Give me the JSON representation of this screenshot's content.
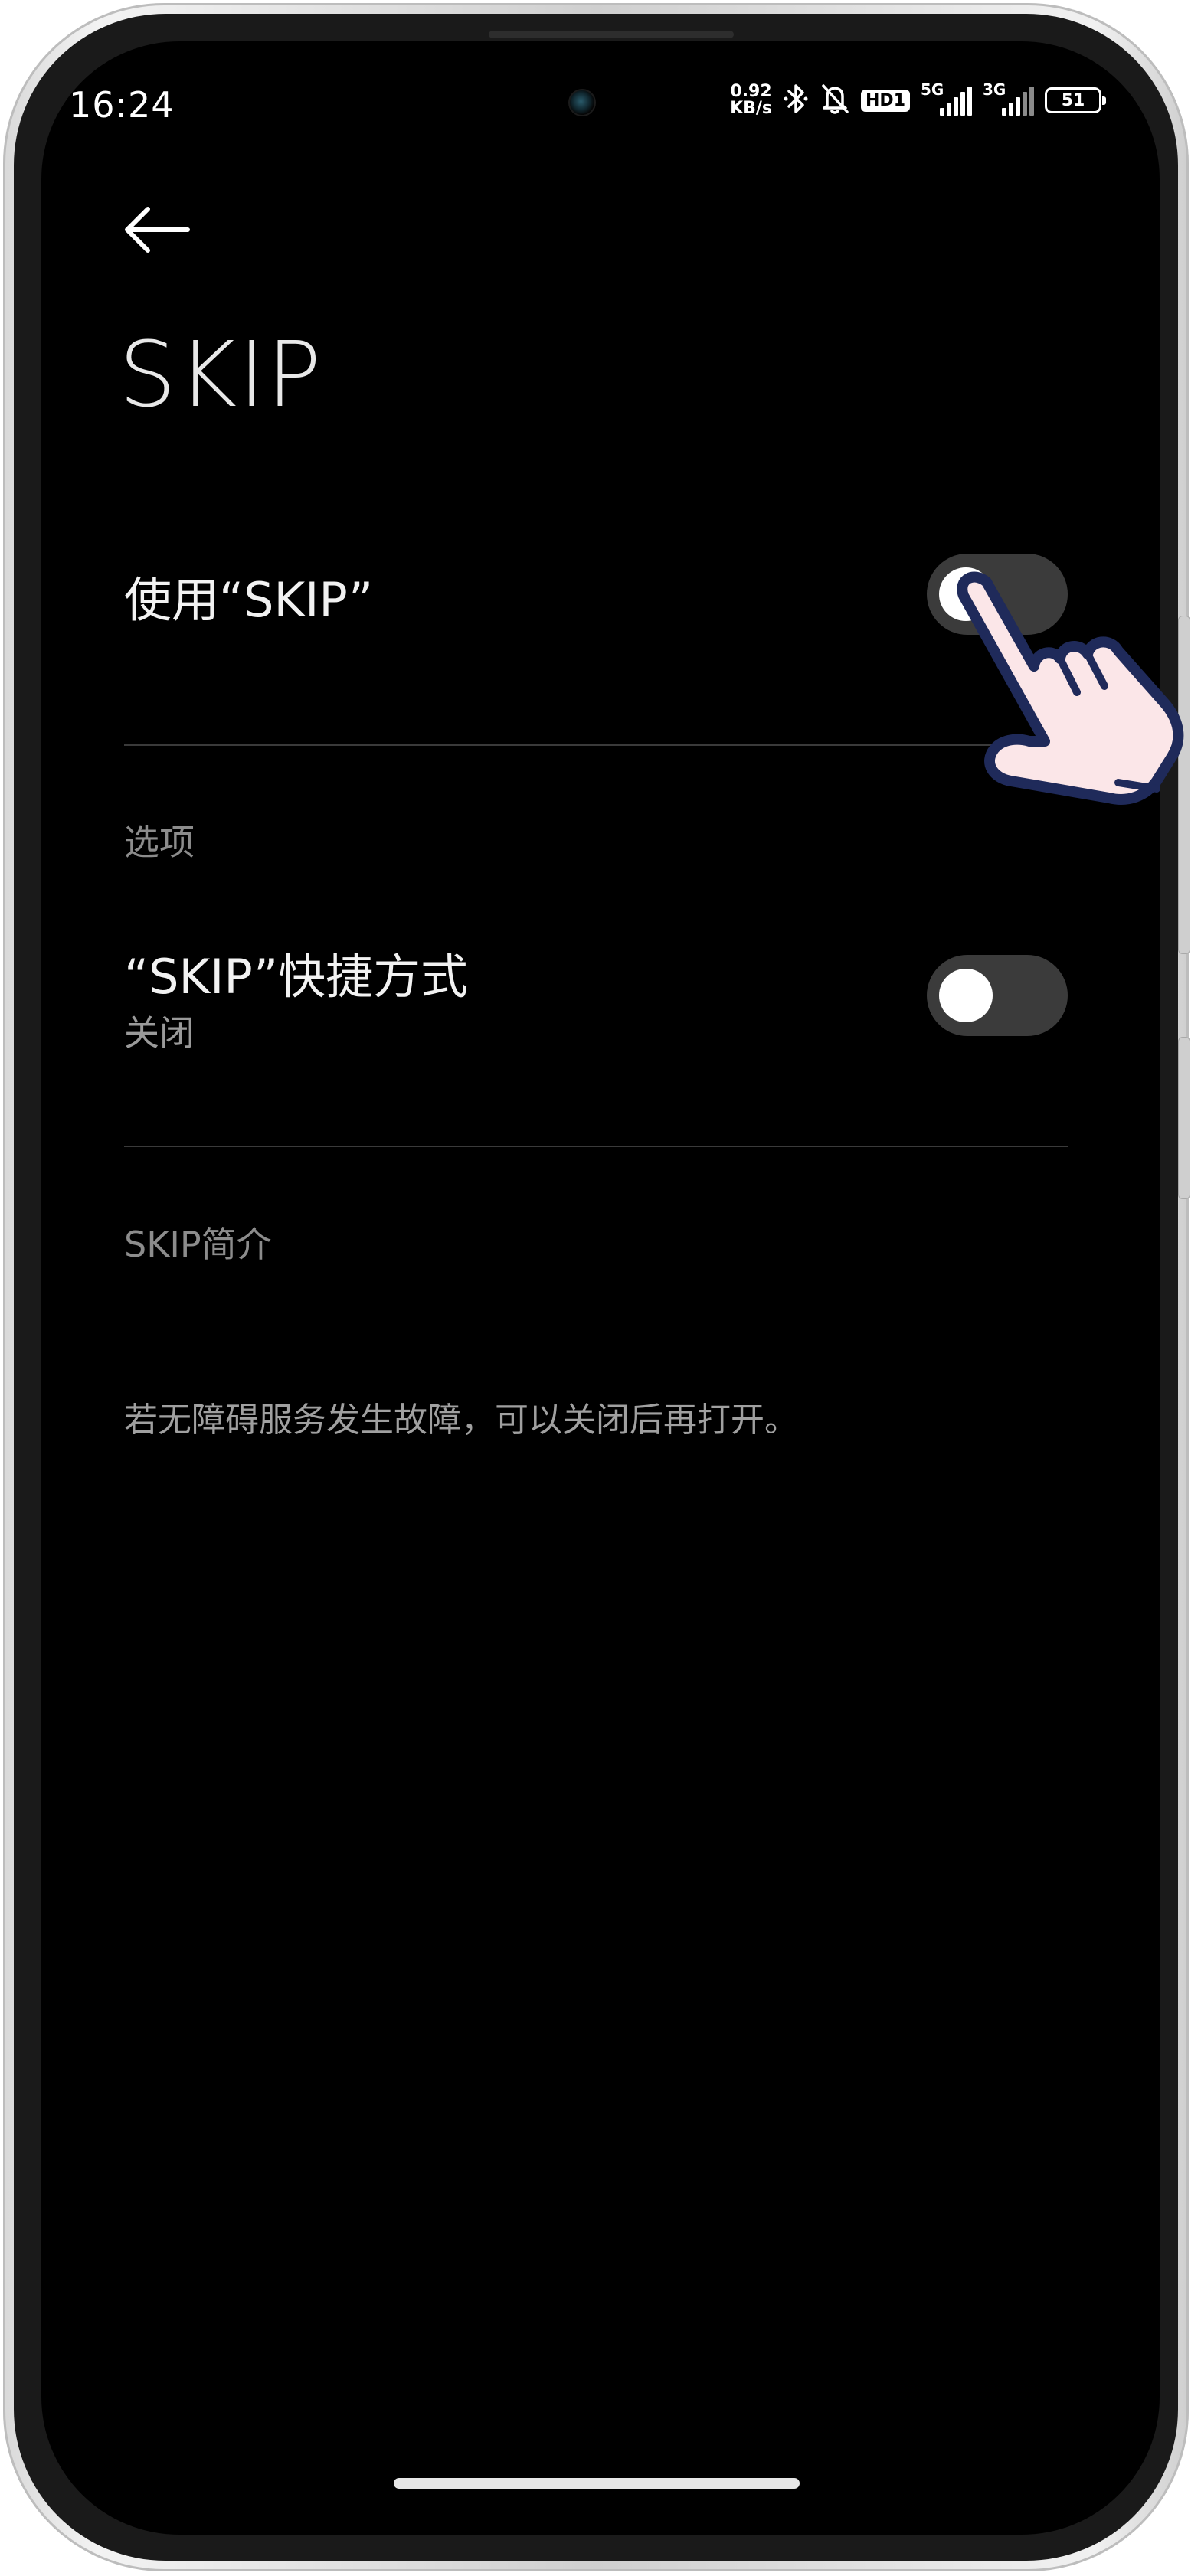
{
  "status_bar": {
    "time": "16:24",
    "net_speed_value": "0.92",
    "net_speed_unit": "KB/s",
    "hd_badge": "HD1",
    "signal_1_label": "5G",
    "signal_2_label": "3G",
    "battery_level": "51",
    "icons": [
      "bluetooth-icon",
      "bell-off-icon"
    ]
  },
  "header": {
    "title": "SKIP"
  },
  "settings": {
    "use_skip": {
      "label": "使用“SKIP”",
      "enabled": false
    },
    "options_section": "选项",
    "shortcut": {
      "label": "“SKIP”快捷方式",
      "status": "关闭",
      "enabled": false
    },
    "intro_section": "SKIP简介",
    "info": "若无障碍服务发生故障，可以关闭后再打开。"
  },
  "colors": {
    "background": "#000000",
    "toggle_track": "#3b3b3b",
    "toggle_knob": "#ffffff",
    "pointer_fill": "#fbe6e8",
    "pointer_outline": "#1f2a5a"
  }
}
